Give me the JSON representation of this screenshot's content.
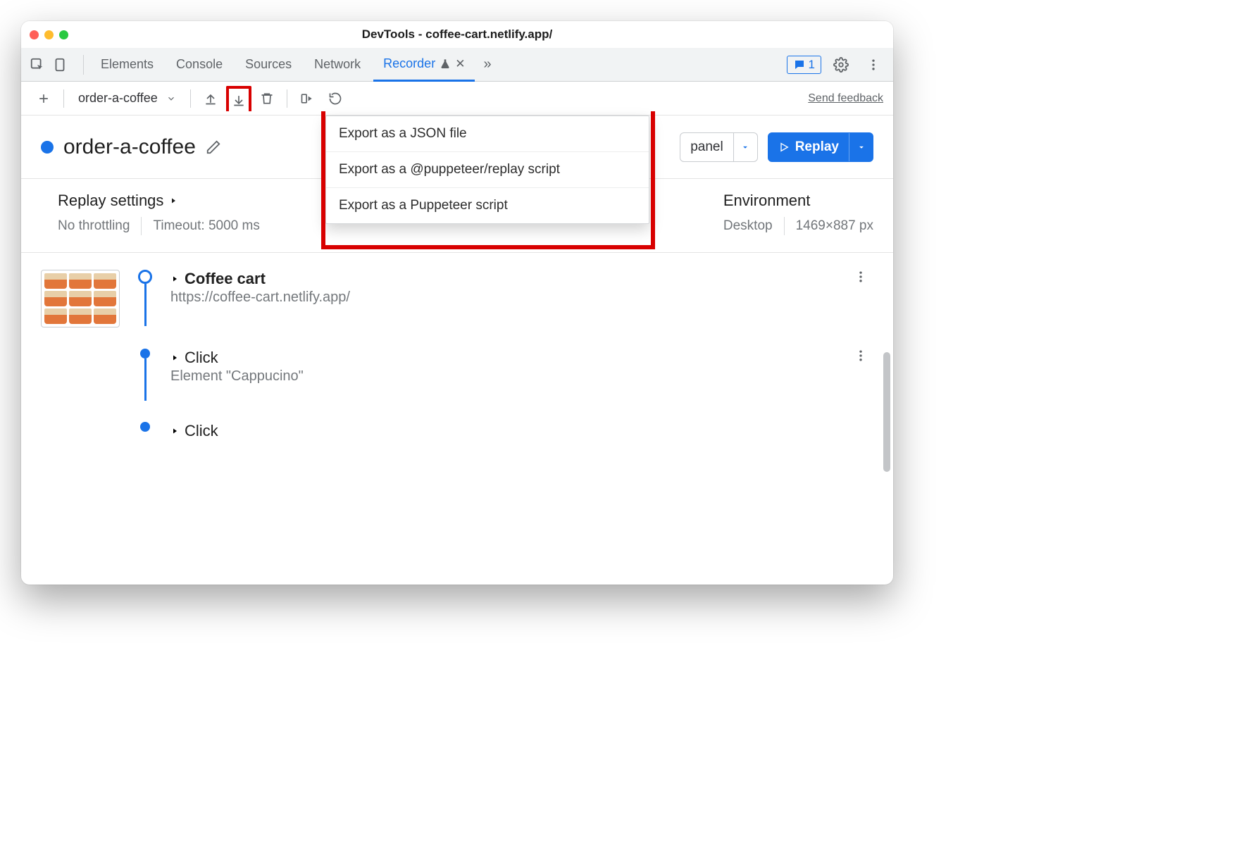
{
  "window": {
    "title": "DevTools - coffee-cart.netlify.app/"
  },
  "tabs": {
    "items": [
      "Elements",
      "Console",
      "Sources",
      "Network",
      "Recorder"
    ],
    "activeIndex": 4,
    "messageCount": "1"
  },
  "subbar": {
    "recording": "order-a-coffee",
    "feedback": "Send feedback"
  },
  "heading": {
    "name": "order-a-coffee",
    "panelLabel": "panel",
    "replayLabel": "Replay"
  },
  "exportMenu": {
    "items": [
      "Export as a JSON file",
      "Export as a @puppeteer/replay script",
      "Export as a Puppeteer script"
    ]
  },
  "settings": {
    "replay": {
      "title": "Replay settings",
      "throttle": "No throttling",
      "timeout": "Timeout: 5000 ms"
    },
    "env": {
      "title": "Environment",
      "device": "Desktop",
      "res": "1469×887 px"
    }
  },
  "steps": [
    {
      "title": "Coffee cart",
      "sub": "https://coffee-cart.netlify.app/",
      "bold": true
    },
    {
      "title": "Click",
      "sub": "Element \"Cappucino\"",
      "bold": false
    },
    {
      "title": "Click",
      "sub": "",
      "bold": false
    }
  ]
}
